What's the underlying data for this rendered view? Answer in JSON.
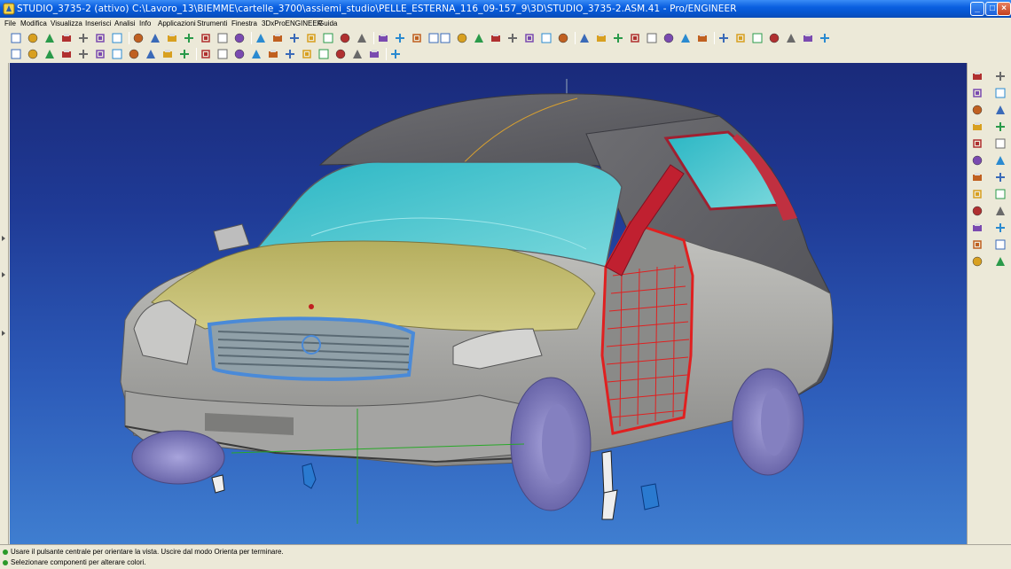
{
  "window": {
    "title": "STUDIO_3735-2 (attivo) C:\\Lavoro_13\\BIEMME\\cartelle_3700\\assiemi_studio\\PELLE_ESTERNA_116_09-157_9\\3D\\STUDIO_3735-2.ASM.41 - Pro/ENGINEER",
    "minimize": "_",
    "maximize": "□",
    "close": "×"
  },
  "menu": [
    "File",
    "Modifica",
    "Visualizza",
    "Inserisci",
    "Analisi",
    "Info",
    "Applicazioni",
    "Strumenti",
    "Finestra",
    "3DxProENGINEER",
    "Guida"
  ],
  "status": {
    "line1": "Usare il pulsante centrale per orientare la vista. Uscire dal modo Orienta per terminare.",
    "line2": "Selezionare componenti per alterare colori."
  },
  "colors": {
    "viewport_top": "#1a2a7a",
    "viewport_bottom": "#3f7ed0",
    "body_gray": "#a8a8a4",
    "hood_yellow": "#b9b46a",
    "glass_cyan": "#36c6d0",
    "door_wire": "#e02020",
    "grille_blue": "#4a8ad8",
    "wheel_lavender": "#8c88c8"
  },
  "icons": {
    "toolbar1": [
      "new-icon",
      "open-icon",
      "save-icon",
      "copy-icon",
      "file-icon",
      "folder-icon",
      "save-as-icon",
      "print-icon",
      "settings-icon",
      "select-icon",
      "layers-icon",
      "saved-view-icon",
      "refit-icon",
      "zoom-in-icon",
      "zoom-out-icon",
      "zoom-box-icon",
      "pan-icon",
      "orient-icon",
      "view-list-icon",
      "repaint-icon",
      "spin-center-icon",
      "wireframe-icon",
      "hidden-line-icon",
      "no-hidden-icon",
      "shaded-icon"
    ],
    "toolbar2": [
      "regen-icon",
      "datum-planes-icon",
      "datum-axes-icon",
      "globe-icon",
      "color-icon",
      "appearance-icon",
      "model-tree-icon",
      "pdf-icon",
      "draft-icon",
      "sketch-icon",
      "feature-icon",
      "edit-icon",
      "printer-icon",
      "rotate-icon",
      "box-icon",
      "part-icon",
      "assembly-icon",
      "mold-icon",
      "sphere-icon",
      "sphere-dark-icon",
      "line-icon",
      "mate-icon",
      "grid-icon"
    ],
    "right": [
      "datum-point-icon",
      "datum-csys-icon",
      "plane-icon",
      "datum-plane-icon",
      "axis-icon",
      "curve-icon",
      "intersect-icon",
      "analysis-icon",
      "table-icon",
      "marker-icon",
      "extrude-icon",
      "revolve-icon",
      "sweep-icon",
      "blend-icon",
      "hole-icon",
      "round-icon",
      "chamfer-icon",
      "shell-icon",
      "rib-icon",
      "draft-icon-2",
      "pattern-icon",
      "mirror-icon",
      "merge-icon",
      "trim-icon"
    ]
  }
}
